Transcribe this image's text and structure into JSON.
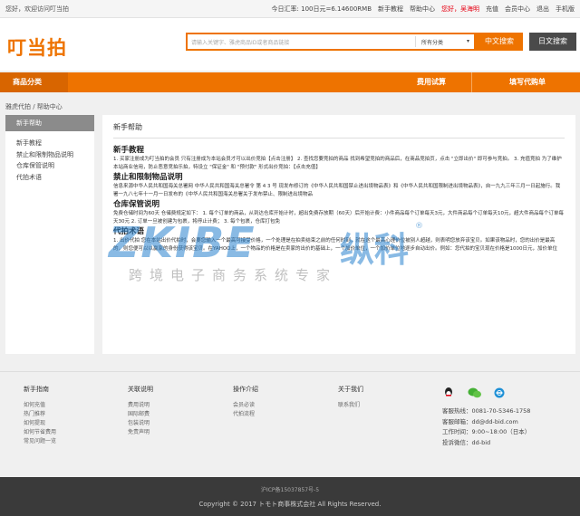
{
  "topbar": {
    "welcome": "您好，欢迎访问叮当拍",
    "rate": "今日汇率: 100日元=6.14600RMB",
    "links": [
      "新手教程",
      "帮助中心"
    ],
    "greeting": "您好，吴海明",
    "links2": [
      "充值",
      "会员中心",
      "退出",
      "手机版"
    ]
  },
  "header": {
    "logo": "叮当拍",
    "search_placeholder": "请输入关键字、雅虎商品ID或者商品链接",
    "category": "所有分类",
    "btn_cn": "中文搜索",
    "btn_jp": "日文搜索"
  },
  "nav": {
    "categories": "商品分类",
    "fee": "费用试算",
    "agent": "填写代购单"
  },
  "breadcrumb": "雅虎代拍 / 帮助中心",
  "sidebar": {
    "head": "新手帮助",
    "items": [
      "新手教程",
      "禁止和限制物品说明",
      "仓库保管说明",
      "代拍术语"
    ]
  },
  "main": {
    "title": "新手帮助",
    "sections": [
      {
        "heading": "新手教程",
        "body": "1. 买家注册成为叮当拍的会员 只有注册成为本站会员才可以出价竞拍【点击注册】 2. 查找您要竞拍的商品 找到希望竞拍的商品后，在商品竞拍页，点击 \"立即出价\" 即可参与竞拍。 3. 充值竞拍 为了维护本站商业信用，防止恶意竞拍乐拍，特设立 \"保证金\" 和 \"预付款\" 形式出价竞拍：【点击充值】"
      },
      {
        "heading": "禁止和限制物品说明",
        "body": "信息来源中华人民共和国海关总署网 中华人民共和国海关总署令 第 4 3 号 现发布修订的《中华人民共和国禁止进出境物品表》和《中华人民共和国限制进出境物品表》，自一九九三年三月一日起施行。我署一九八七年十一月一日发布的《中华人民共和国海关总署关于发布禁止、限制进出境物品"
      },
      {
        "heading": "仓库保管说明",
        "body": "免费仓储时间为60天 仓储费规定如下： 1. 每个订单的商品，从到达仓库开始计时，超出免费存放期（60天）后开始计费：小件商品每个订单每天3元，大件商品每个订单每天10元，超大件商品每个订单每天30元 2. 订单一旦被创建为包裹，将停止计费； 3. 每个包裹，仓库打包免"
      },
      {
        "heading": "代拍术语",
        "body": "1. 出价代拍 您在本站出价代拍时，会要您输入一个最高可接受价格，一个处理是在拍卖结束之前的任何时刻，就在这个最高心理价位被别人超越，则表明您放弃该宝贝。如果该物品时，您的出价是最高的，则您便可以以赢家的身份获得该宝贝。在YAHOO上，一个物品的价格是在卖家的出价的基础上，一个加价单位，一个加价单位地逐步自动出价。例如：您代拍的宝贝现在价格是1000日元，加价单位"
      }
    ]
  },
  "watermark": {
    "brand": "ZKIBE",
    "cn": "纵科",
    "reg": "®",
    "slogan": "跨境电子商务系统专家"
  },
  "footer": {
    "columns": [
      {
        "head": "新手指南",
        "links": [
          "如何充值",
          "热门推荐",
          "如何提现",
          "如何节省费用",
          "常见问题一览"
        ]
      },
      {
        "head": "关联说明",
        "links": [
          "费用说明",
          "国际邮费",
          "包装说明",
          "免责声明"
        ]
      },
      {
        "head": "操作介绍",
        "links": [
          "会员必读",
          "代拍流程"
        ]
      },
      {
        "head": "关于我们",
        "links": [
          "联系我们"
        ]
      }
    ],
    "contact": [
      "客服热线：0081-70-5346-1758",
      "客服邮箱：dd@dd-bid.com",
      "工作时间：9:00~18:00（日本）",
      "投诉微信：dd-bid"
    ],
    "icp": "沪ICP备15037857号-5",
    "copyright": "Copyright © 2017 トモト商事株式会社 All Rights Reserved."
  },
  "colors": {
    "accent": "#ee7300",
    "nav_dark": "#d86500",
    "watermark": "#2882cd",
    "footer_bg": "#3a3a3a"
  }
}
